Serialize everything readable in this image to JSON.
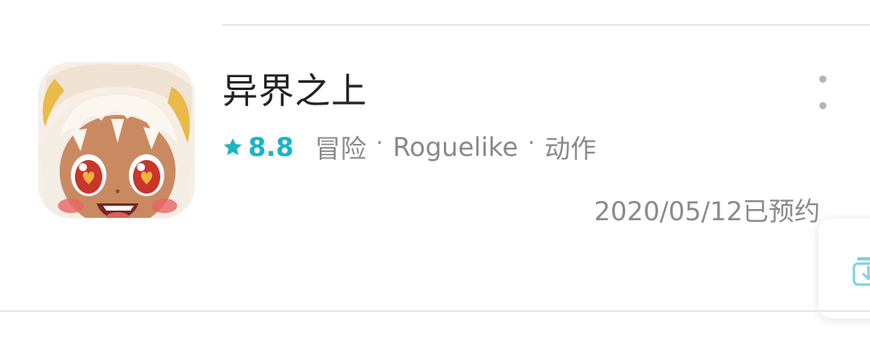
{
  "app": {
    "title": "异界之上",
    "rating": "8.8",
    "tags": [
      "冒险",
      "Roguelike",
      "动作"
    ],
    "separator": "·",
    "status": "2020/05/12已预约"
  },
  "icons": {
    "rating": "star-icon",
    "more": "more-vertical-icon",
    "floating": "download-icon",
    "app": "app-icon"
  },
  "colors": {
    "accent": "#1bb5c4",
    "title": "#222222",
    "secondary": "#8a8a8a",
    "divider": "#e6e6e6"
  }
}
